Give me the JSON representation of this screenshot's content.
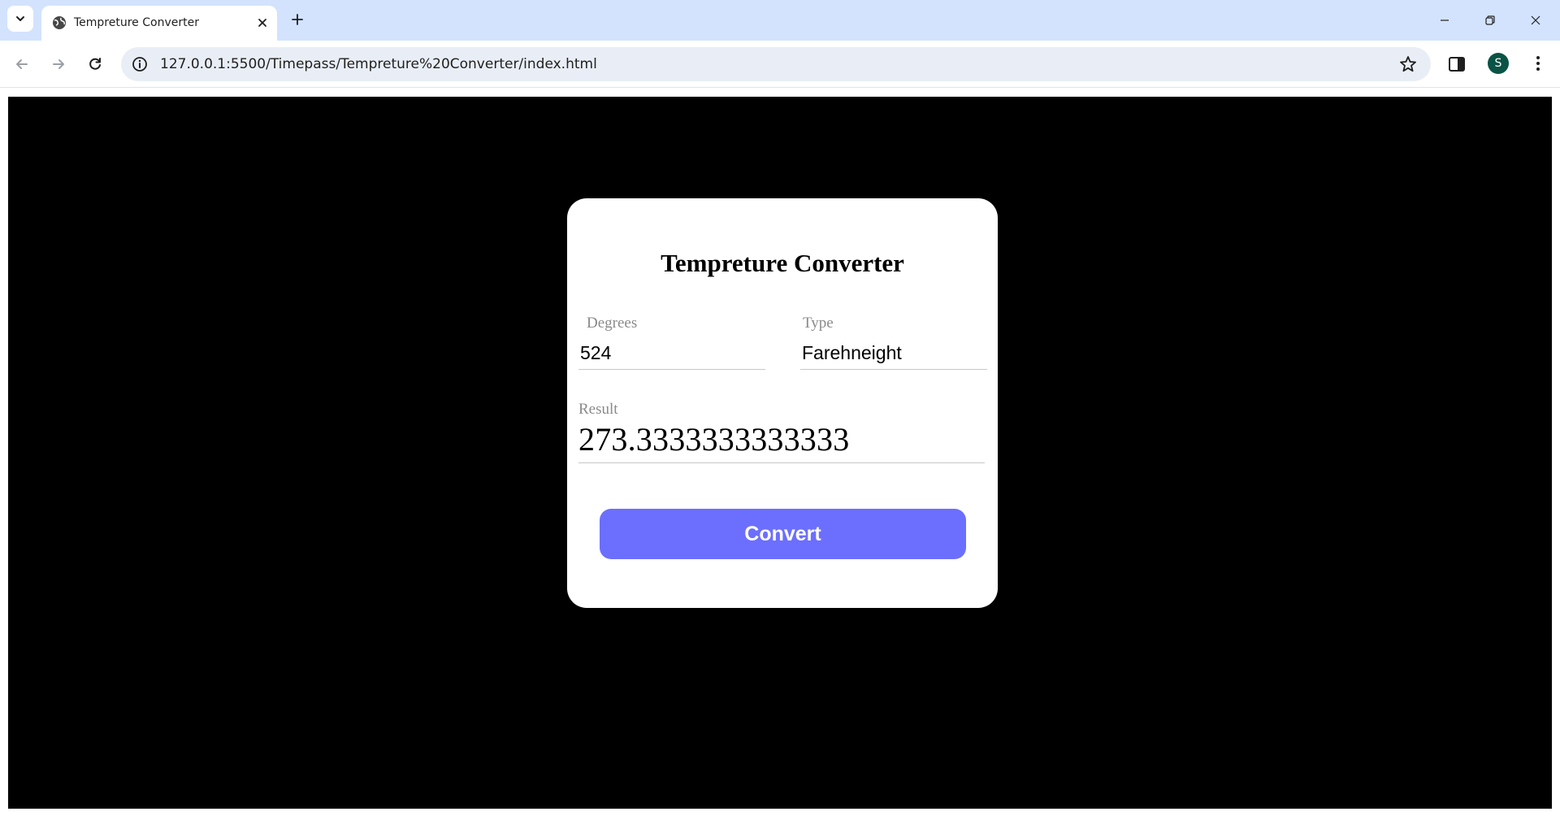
{
  "browser": {
    "tab_title": "Tempreture Converter",
    "url": "127.0.0.1:5500/Timepass/Tempreture%20Converter/index.html",
    "profile_initial": "S",
    "profile_color": "#0b5345",
    "chrome_color": "#d3e3fd"
  },
  "app": {
    "title": "Tempreture Converter",
    "degrees_label": "Degrees",
    "degrees_value": "524",
    "type_label": "Type",
    "type_value": "Farehneight",
    "result_label": "Result",
    "result_value": "273.3333333333333",
    "convert_label": "Convert",
    "accent_color": "#6c6ffd",
    "page_background": "#000000"
  }
}
